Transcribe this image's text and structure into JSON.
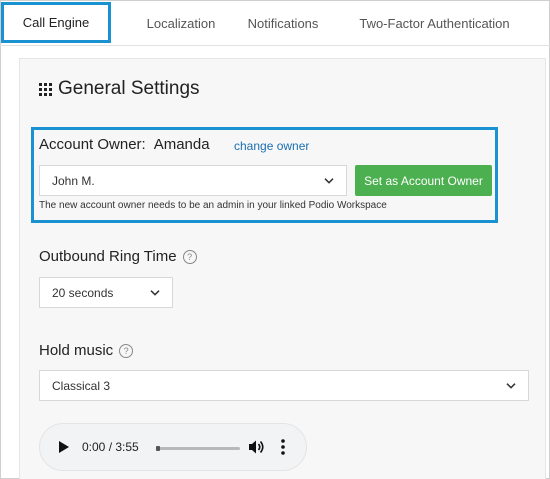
{
  "tabs": [
    {
      "label": "Call Engine",
      "active": true
    },
    {
      "label": "Localization",
      "active": false
    },
    {
      "label": "Notifications",
      "active": false
    },
    {
      "label": "Two-Factor Authentication",
      "active": false
    }
  ],
  "section": {
    "title": "General Settings",
    "icon": "grid-icon"
  },
  "account_owner": {
    "label": "Account Owner:",
    "name": "Amanda",
    "change_link": "change owner",
    "select_value": "John M.",
    "button_label": "Set as Account Owner",
    "hint": "The new account owner needs to be an admin in your linked Podio Workspace"
  },
  "ring_time": {
    "label": "Outbound Ring Time",
    "help_icon": "?",
    "select_value": "20 seconds"
  },
  "hold_music": {
    "label": "Hold music",
    "help_icon": "?",
    "select_value": "Classical 3"
  },
  "audio_player": {
    "time": "0:00 / 3:55",
    "progress": 0
  },
  "colors": {
    "highlight": "#1a91d0",
    "button_green": "#4caf50",
    "link": "#1a6fb0"
  }
}
